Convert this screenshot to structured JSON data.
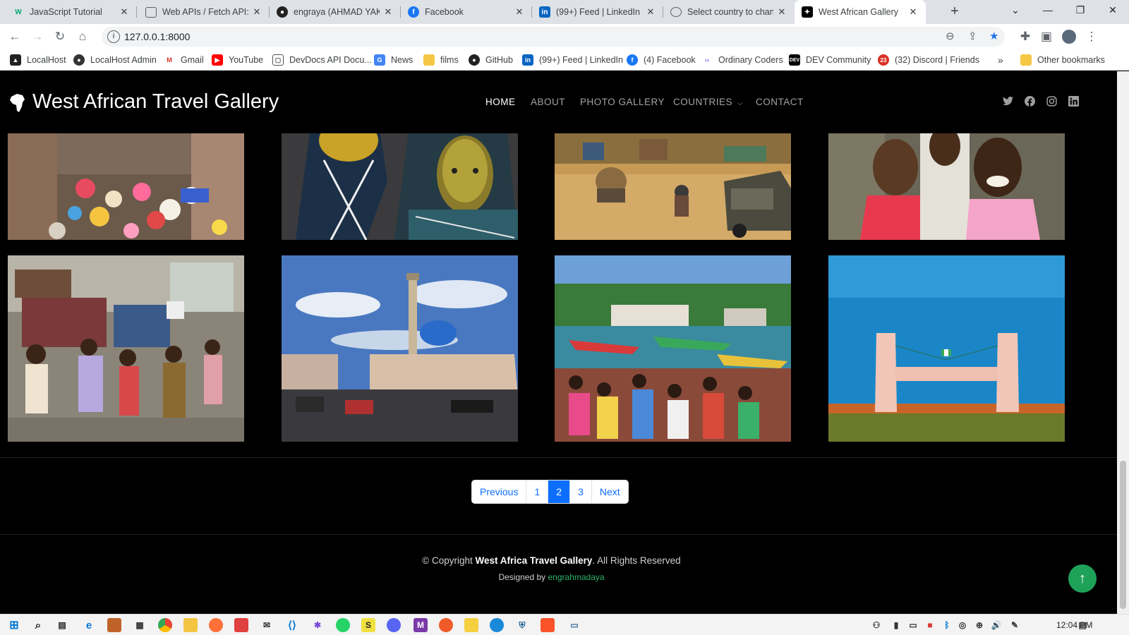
{
  "browser": {
    "tabs": [
      {
        "title": "JavaScript Tutorial",
        "icon": "w3schools-icon"
      },
      {
        "title": "Web APIs / Fetch API: U",
        "icon": "document-icon"
      },
      {
        "title": "engraya (AHMAD YAKU",
        "icon": "github-icon"
      },
      {
        "title": "Facebook",
        "icon": "facebook-icon"
      },
      {
        "title": "(99+) Feed | LinkedIn",
        "icon": "linkedin-icon"
      },
      {
        "title": "Select country to chang",
        "icon": "globe-icon"
      },
      {
        "title": "West African Gallery",
        "icon": "africa-icon"
      }
    ],
    "url": "127.0.0.1:8000",
    "bookmarks": [
      "LocalHost",
      "LocalHost Admin",
      "Gmail",
      "YouTube",
      "DevDocs API Docu...",
      "News",
      "films",
      "GitHub",
      "(99+) Feed | LinkedIn",
      "(4) Facebook",
      "Ordinary Coders",
      "DEV Community",
      "(32) Discord | Friends"
    ],
    "more_bookmarks": "»",
    "other_bookmarks": "Other bookmarks"
  },
  "site": {
    "logo": "West African Travel Gallery",
    "nav": {
      "home": "HOME",
      "about": "ABOUT",
      "photo_gallery": "PHOTO GALLERY",
      "countries": "COUNTRIES",
      "contact": "CONTACT"
    },
    "social": [
      "twitter-icon",
      "facebook-icon",
      "instagram-icon",
      "linkedin-icon"
    ]
  },
  "pagination": {
    "previous": "Previous",
    "pages": [
      "1",
      "2",
      "3"
    ],
    "current": "2",
    "next": "Next"
  },
  "footer": {
    "copyright_prefix": "© Copyright",
    "copyright_name": "West Africa Travel Gallery",
    "copyright_suffix": ". All Rights Reserved",
    "designed_prefix": "Designed by",
    "designed_by": "engrahmadaya"
  },
  "taskbar": {
    "time": "12:04 PM"
  },
  "colors": {
    "accent_blue": "#0d6efd",
    "to_top_green": "#1ea25a",
    "designer_link": "#2fb36b"
  }
}
